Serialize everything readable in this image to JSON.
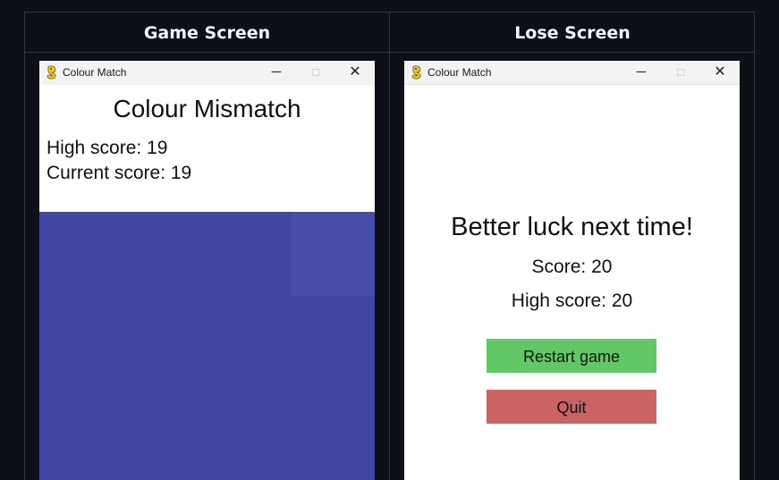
{
  "table": {
    "headers": [
      "Game Screen",
      "Lose Screen"
    ]
  },
  "game_window": {
    "title": "Colour Match",
    "controls": {
      "minimize": "─",
      "maximize": "□",
      "close": "✕"
    },
    "heading": "Colour Mismatch",
    "high_score": "High score: 19",
    "current_score": "Current score: 19",
    "play_color": "#4246a3",
    "tile_color": "#474ca9"
  },
  "lose_window": {
    "title": "Colour Match",
    "controls": {
      "minimize": "─",
      "maximize": "□",
      "close": "✕"
    },
    "heading": "Better luck next time!",
    "score": "Score: 20",
    "high_score": "High score: 20",
    "restart_label": "Restart game",
    "quit_label": "Quit",
    "restart_color": "#62c866",
    "quit_color": "#c96462"
  },
  "icons": {
    "app": "pygame-snake-icon"
  }
}
